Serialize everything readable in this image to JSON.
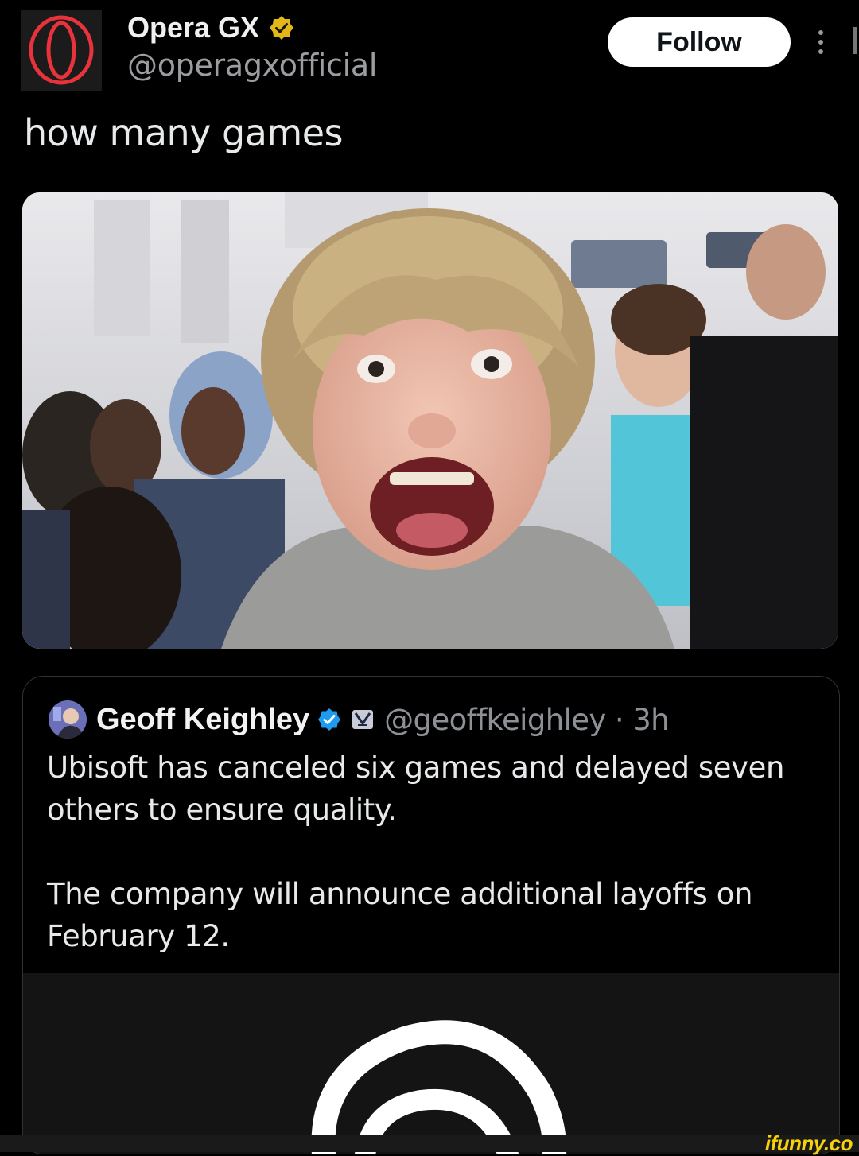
{
  "post": {
    "author": {
      "display_name": "Opera GX",
      "handle": "@operagxofficial",
      "avatar_icon": "opera-gx-logo-icon",
      "verified_icon": "gold-verified-badge-icon",
      "brand_color": "#e8323c"
    },
    "follow_label": "Follow",
    "more_icon": "vertical-ellipsis-icon",
    "text": "how many games",
    "media_icon": "excited-crowd-photo"
  },
  "quote": {
    "author": {
      "display_name": "Geoff Keighley",
      "verified_icon": "blue-verified-badge-icon",
      "affiliate_icon": "game-awards-badge-icon",
      "handle_time": "@geoffkeighley · 3h"
    },
    "body": [
      "Ubisoft has canceled six games and delayed seven others to ensure quality.",
      "The company will announce additional layoffs on February 12."
    ],
    "media_icon": "ubisoft-logo-icon"
  },
  "watermark": "ifunny.co",
  "colors": {
    "background": "#000000",
    "text": "#e7e9ea",
    "muted": "#9b9da1",
    "verified_blue": "#1d9bf0",
    "verified_gold": "#e2b719",
    "watermark": "#f5d20a"
  }
}
